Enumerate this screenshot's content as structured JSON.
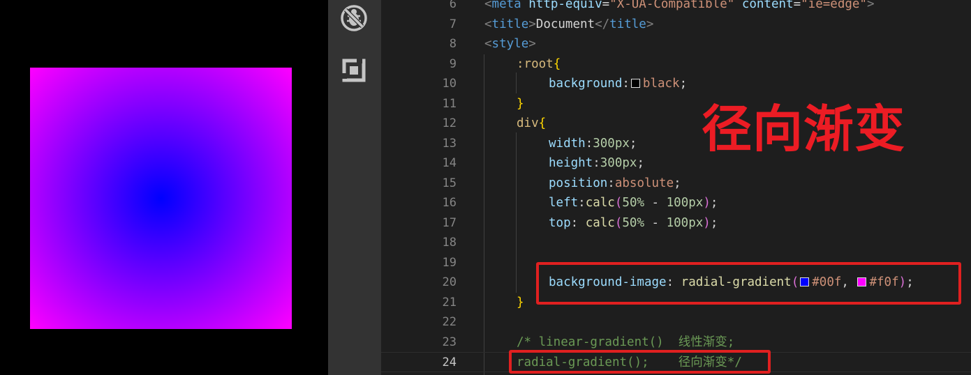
{
  "preview": {
    "gradient_inner": "#0000ff",
    "gradient_outer": "#ff00ff"
  },
  "activity_bar": {
    "icons": [
      "debug-disabled-icon",
      "extensions-icon"
    ]
  },
  "editor": {
    "lines": [
      {
        "n": "6"
      },
      {
        "n": "7"
      },
      {
        "n": "8"
      },
      {
        "n": "9"
      },
      {
        "n": "10"
      },
      {
        "n": "11"
      },
      {
        "n": "12"
      },
      {
        "n": "13"
      },
      {
        "n": "14"
      },
      {
        "n": "15"
      },
      {
        "n": "16"
      },
      {
        "n": "17"
      },
      {
        "n": "18"
      },
      {
        "n": "19"
      },
      {
        "n": "20"
      },
      {
        "n": "21"
      },
      {
        "n": "22"
      },
      {
        "n": "23"
      },
      {
        "n": "24"
      }
    ],
    "t": {
      "l6_lt": "<",
      "l6_tag": "meta",
      "l6_a1": "http-equiv",
      "l6_eq1": "=",
      "l6_s1": "\"X-UA-Compatible\"",
      "l6_a2": "content",
      "l6_eq2": "=",
      "l6_s2": "\"ie=edge\"",
      "l6_gt": ">",
      "l7_lt": "<",
      "l7_tag": "title",
      "l7_gt": ">",
      "l7_txt": "Document",
      "l7_lt2": "</",
      "l7_tag2": "title",
      "l7_gt2": ">",
      "l8_lt": "<",
      "l8_tag": "style",
      "l8_gt": ">",
      "l9_sel": ":root",
      "l9_br": "{",
      "l10_prop": "background",
      "l10_colon": ":",
      "l10_val": "black",
      "l10_semi": ";",
      "l11_br": "}",
      "l12_sel": "div",
      "l12_br": "{",
      "l13_prop": "width",
      "l13_colon": ":",
      "l13_val": "300px",
      "l13_semi": ";",
      "l14_prop": "height",
      "l14_colon": ":",
      "l14_val": "300px",
      "l14_semi": ";",
      "l15_prop": "position",
      "l15_colon": ":",
      "l15_val": "absolute",
      "l15_semi": ";",
      "l16_prop": "left",
      "l16_colon": ":",
      "l16_fn": "calc",
      "l16_p1": "(",
      "l16_n1": "50%",
      "l16_op": " - ",
      "l16_n2": "100px",
      "l16_p2": ")",
      "l16_semi": ";",
      "l17_prop": "top",
      "l17_colon": ": ",
      "l17_fn": "calc",
      "l17_p1": "(",
      "l17_n1": "50%",
      "l17_op": " - ",
      "l17_n2": "100px",
      "l17_p2": ")",
      "l17_semi": ";",
      "l20_prop": "background-image",
      "l20_colon": ": ",
      "l20_fn": "radial-gradient",
      "l20_p1": "(",
      "l20_c1": "#00f",
      "l20_comma": ", ",
      "l20_c2": "#f0f",
      "l20_p2": ")",
      "l20_semi": ";",
      "l21_br": "}",
      "l23_cmt": "/* linear-gradient()  线性渐变;",
      "l24_cmt": "radial-gradient();    径向渐变*/"
    },
    "swatch_colors": {
      "black": "#000000",
      "blue": "#0000ff",
      "magenta": "#ff00ff"
    }
  },
  "callout": {
    "text": "径向渐变",
    "color": "#ec1c24"
  },
  "highlight_color": "#e02020"
}
